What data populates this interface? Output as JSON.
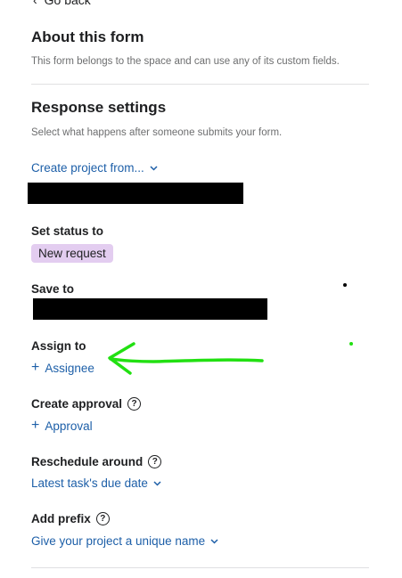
{
  "nav": {
    "back_label": "Go back"
  },
  "about": {
    "title": "About this form",
    "description": "This form belongs to the space and can use any of its custom fields."
  },
  "response": {
    "title": "Response settings",
    "description": "Select what happens after someone submits your form.",
    "create_project_link": "Create project from..."
  },
  "status": {
    "label": "Set status to",
    "value": "New request"
  },
  "save_to": {
    "label": "Save to"
  },
  "assign_to": {
    "label": "Assign to",
    "action": "Assignee"
  },
  "approval": {
    "label": "Create approval",
    "action": "Approval"
  },
  "reschedule": {
    "label": "Reschedule around",
    "value": "Latest task's due date"
  },
  "prefix": {
    "label": "Add prefix",
    "value": "Give your project a unique name"
  },
  "colors": {
    "accent": "#1d5fa8",
    "status_pill": "#e3cdf0",
    "annotation": "#22e012"
  }
}
